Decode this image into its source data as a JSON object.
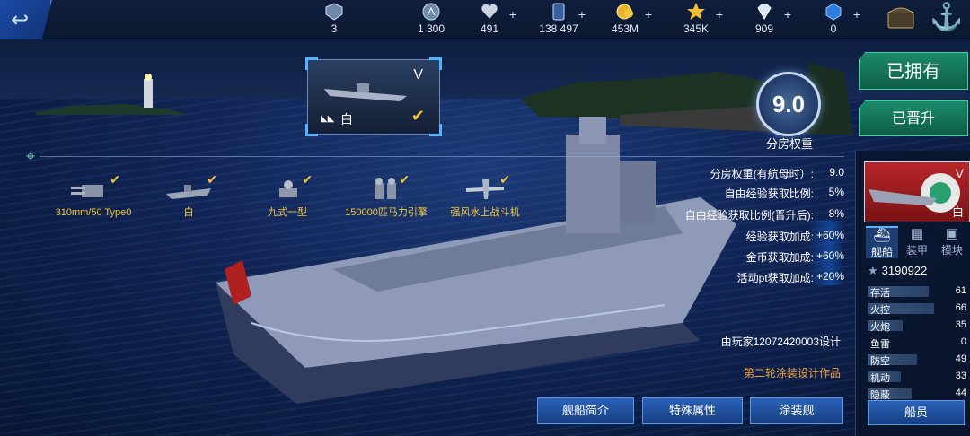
{
  "topbar": {
    "back_icon": "back-arrow-icon",
    "resources": [
      {
        "name": "rank",
        "icon": "rank-badge-icon",
        "value": "3",
        "plus": false
      },
      {
        "name": "credits",
        "icon": "compass-coin-icon",
        "value": "1 300",
        "plus": false
      },
      {
        "name": "hearts",
        "icon": "heart-icon",
        "value": "491",
        "plus": true
      },
      {
        "name": "cards",
        "icon": "card-icon",
        "value": "138 497",
        "plus": true
      },
      {
        "name": "gold",
        "icon": "gold-coin-icon",
        "value": "453M",
        "plus": true
      },
      {
        "name": "stars",
        "icon": "star-icon",
        "value": "345K",
        "plus": true
      },
      {
        "name": "diamonds",
        "icon": "diamond-icon",
        "value": "909",
        "plus": true
      },
      {
        "name": "gems",
        "icon": "blue-gem-icon",
        "value": "0",
        "plus": true
      }
    ]
  },
  "ship_card": {
    "tier": "V",
    "name": "白"
  },
  "rating": {
    "value": "9.0",
    "label": "分房权重"
  },
  "buttons": {
    "owned": "已拥有",
    "promoted": "已晋升",
    "intro": "舰船简介",
    "special": "特殊属性",
    "skin": "涂装舰",
    "crew": "船员"
  },
  "equipment": [
    {
      "label": "310mm/50 Type0"
    },
    {
      "label": "白"
    },
    {
      "label": "九式一型"
    },
    {
      "label": "150000匹马力引擎"
    },
    {
      "label": "强风水上战斗机"
    }
  ],
  "stats": [
    {
      "label": "分房权重(有航母时）:",
      "value": "9.0"
    },
    {
      "label": "自由经验获取比例:",
      "value": "5%"
    },
    {
      "label": "自由经验获取比例(晋升后):",
      "value": "8%"
    },
    {
      "label": "经验获取加成:",
      "value": "+60%"
    },
    {
      "label": "金币获取加成:",
      "value": "+60%"
    },
    {
      "label": "活动pt获取加成:",
      "value": "+20%"
    }
  ],
  "designer": "由玩家12072420003设计",
  "round": "第二轮涂装设计作品",
  "panel": {
    "tier": "V",
    "name": "白",
    "tabs": [
      {
        "label": "舰船",
        "icon": "ship-tab-icon",
        "active": true
      },
      {
        "label": "装甲",
        "icon": "armor-tab-icon",
        "active": false
      },
      {
        "label": "模块",
        "icon": "module-tab-icon",
        "active": false
      }
    ],
    "player_id": "3190922",
    "attributes": [
      {
        "label": "存活",
        "value": "61"
      },
      {
        "label": "火控",
        "value": "66"
      },
      {
        "label": "火炮",
        "value": "35"
      },
      {
        "label": "鱼雷",
        "value": "0"
      },
      {
        "label": "防空",
        "value": "49"
      },
      {
        "label": "机动",
        "value": "33"
      },
      {
        "label": "隐蔽",
        "value": "44"
      }
    ],
    "attr_max": 100
  }
}
